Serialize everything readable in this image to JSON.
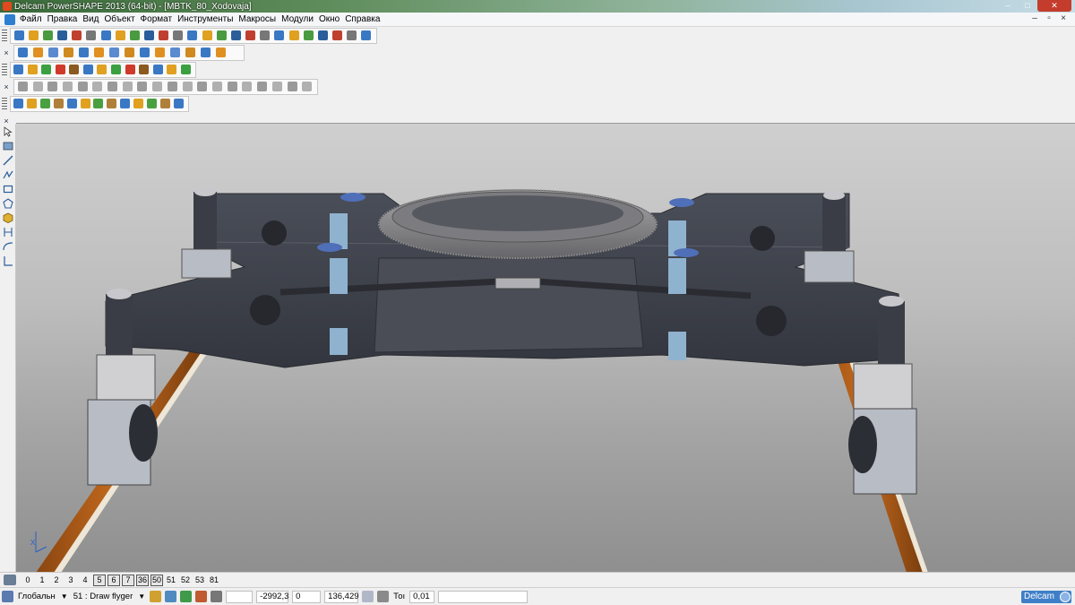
{
  "window": {
    "title": "Delcam PowerSHAPE 2013 (64-bit) - [MBTK_80_Xodovaja]",
    "controls": [
      "–",
      "□",
      "✕"
    ]
  },
  "menu": {
    "items": [
      "Файл",
      "Правка",
      "Вид",
      "Объект",
      "Формат",
      "Инструменты",
      "Макросы",
      "Модули",
      "Окно",
      "Справка"
    ],
    "mdi_controls": [
      "–",
      "▫",
      "×"
    ]
  },
  "toolbars": {
    "rows": [
      {
        "count": 25,
        "colors": [
          "#3a78c4",
          "#e0a020",
          "#4a9a40",
          "#2a5e9a",
          "#c04030",
          "#777777"
        ]
      },
      {
        "count": 14,
        "colors": [
          "#3a78c4",
          "#e09020",
          "#5a8ad0",
          "#d08a20"
        ]
      },
      {
        "count": 13,
        "colors": [
          "#3a78c4",
          "#e0a020",
          "#3aa040",
          "#d03a2a",
          "#8a5a20"
        ]
      },
      {
        "count": 20,
        "colors": [
          "#9a9a9a",
          "#b0b0b0"
        ]
      },
      {
        "count": 13,
        "colors": [
          "#3a78c4",
          "#e0a020",
          "#4aa040",
          "#b0803a"
        ]
      }
    ]
  },
  "palette": {
    "tools": [
      "select-icon",
      "wireframe-icon",
      "line-icon",
      "arc-icon",
      "rectangle-icon",
      "polygon-icon",
      "solid-icon",
      "dimension-icon",
      "curve-icon",
      "surface-icon"
    ]
  },
  "levels": {
    "items": [
      {
        "label": "0",
        "on": false
      },
      {
        "label": "1",
        "on": false
      },
      {
        "label": "2",
        "on": false
      },
      {
        "label": "3",
        "on": false
      },
      {
        "label": "4",
        "on": false
      },
      {
        "label": "5",
        "on": true
      },
      {
        "label": "6",
        "on": true
      },
      {
        "label": "7",
        "on": true
      },
      {
        "label": "36",
        "on": true
      },
      {
        "label": "50",
        "on": true
      },
      {
        "label": "51",
        "on": false
      },
      {
        "label": "52",
        "on": false
      },
      {
        "label": "53",
        "on": false
      },
      {
        "label": "81",
        "on": false
      }
    ]
  },
  "status": {
    "workplane": "Глобальн",
    "level": "51 : Draw flyger",
    "coord_x": "-2992,3",
    "coord_y": "0",
    "coord_z": "136,429",
    "tolerance_label": "Тоı",
    "tolerance_value": "0,01",
    "brand": "Delcam"
  },
  "colors": {
    "model_body": "#3f424c",
    "ring_gear": "#8a8a8c",
    "rail_orange": "#b6621a",
    "rail_top": "#e8e0d0",
    "piston_blue": "#8fb2cf",
    "cap_blue": "#4f6fb8"
  }
}
